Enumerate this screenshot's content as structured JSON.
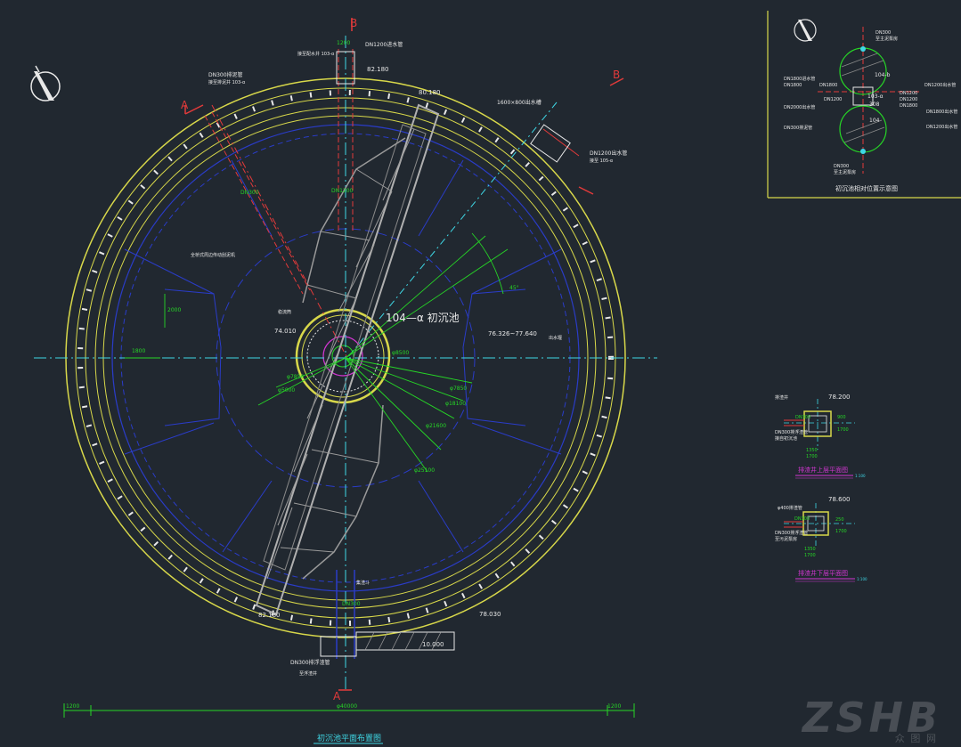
{
  "colors": {
    "background": "#212830",
    "yellow": "#d8d84a",
    "blue": "#2a3cc8",
    "green": "#26d626",
    "cyan": "#3fd8e6",
    "red": "#e23a3a",
    "magenta": "#d236d2",
    "white": "#e8e8e8",
    "gray": "#9a9a9a"
  },
  "main_plan": {
    "title": "初沉池平面布置图",
    "pool_label": "104—α 初沉池",
    "section_markers": {
      "a_top": "A",
      "a_bottom": "A",
      "b_top": "B",
      "b_right": "B"
    },
    "elevations": {
      "top": "82.180",
      "bridge_top": "80.180",
      "center_left": "74.010",
      "right_mid": "76.326~77.640",
      "bottom_left": "82.180",
      "bottom_right": "78.030",
      "bottom_weir": "10.000"
    },
    "dims": {
      "top_width": "1200",
      "overall": "φ40000",
      "left_end": "1200",
      "right_end": "1200",
      "r1": "φ7850",
      "r2": "φ18100",
      "r3": "φ21600",
      "r4": "φ25100",
      "c1": "φ8500",
      "c2": "φ5000",
      "c3": "φ7850",
      "left_gap": "2000",
      "left_arc": "1800",
      "angle": "45°"
    },
    "pipes": {
      "top_pipe": "DN1200",
      "top_note": "DN1200进水管",
      "top_ref": "接至配水井 103-α",
      "left_pipe": "DN300",
      "left_note": "DN300排泥管",
      "left_ref": "接至排泥井 103-α",
      "bridge_pipe": "DN1200",
      "inclined_pipe": "DN300",
      "right_note": "DN1200出水管",
      "right_ref": "接至 105-α",
      "right_box": "1600×800出水槽",
      "bottom_pipe": "DN300",
      "bottom_note": "DN300排浮渣管",
      "bottom_ref": "至浮渣井",
      "bottom_vert": "DN300",
      "left_annot": "全桥式周边传动刮泥机",
      "right_annot": "出水堰",
      "center_annot": "稳流筒",
      "bottom_center": "集渣斗"
    }
  },
  "inset_position": {
    "title": "初沉池相对位置示意图",
    "labels": {
      "n1": "104-b",
      "n2": "103-α",
      "n3": "308",
      "n4": "104",
      "top_pipe": "DN300",
      "top_note": "至主泥泵房",
      "left1": "DN1800",
      "left2": "DN1800",
      "left3": "DN1200",
      "left_n1": "DN1800进水管",
      "left_n2": "DN2000出水管",
      "left_n3": "DN300排泥管",
      "right1": "DN1200",
      "right2": "DN1200",
      "right3": "DN1800",
      "right_n1": "DN1200出水管",
      "right_n2": "DN1800出水管",
      "right_n3": "DN1200出水管",
      "bottom_pipe": "DN300",
      "bottom_note": "至主泥泵房"
    }
  },
  "detail_upper": {
    "title": "排渣井上层平面图",
    "scale": "1:100",
    "elev": "78.200",
    "pipe_in": "DN300",
    "pipe_note": "DN300排浮渣管",
    "pipe_ref": "接自初沉池",
    "d1": "1350",
    "d2": "1700",
    "d3": "900",
    "d4": "1700",
    "label": "排渣井"
  },
  "detail_lower": {
    "title": "排渣井下层平面图",
    "scale": "1:100",
    "elev": "78.600",
    "pipe_in": "DN300",
    "pipe_note": "DN300排浮渣管",
    "pipe_ref": "至污泥泵房",
    "d1": "1350",
    "d2": "1700",
    "d3": "250",
    "d4": "1700",
    "top_note": "φ400排渣管"
  },
  "watermark": {
    "main": "ZSHB",
    "sub": "众 图 网"
  }
}
